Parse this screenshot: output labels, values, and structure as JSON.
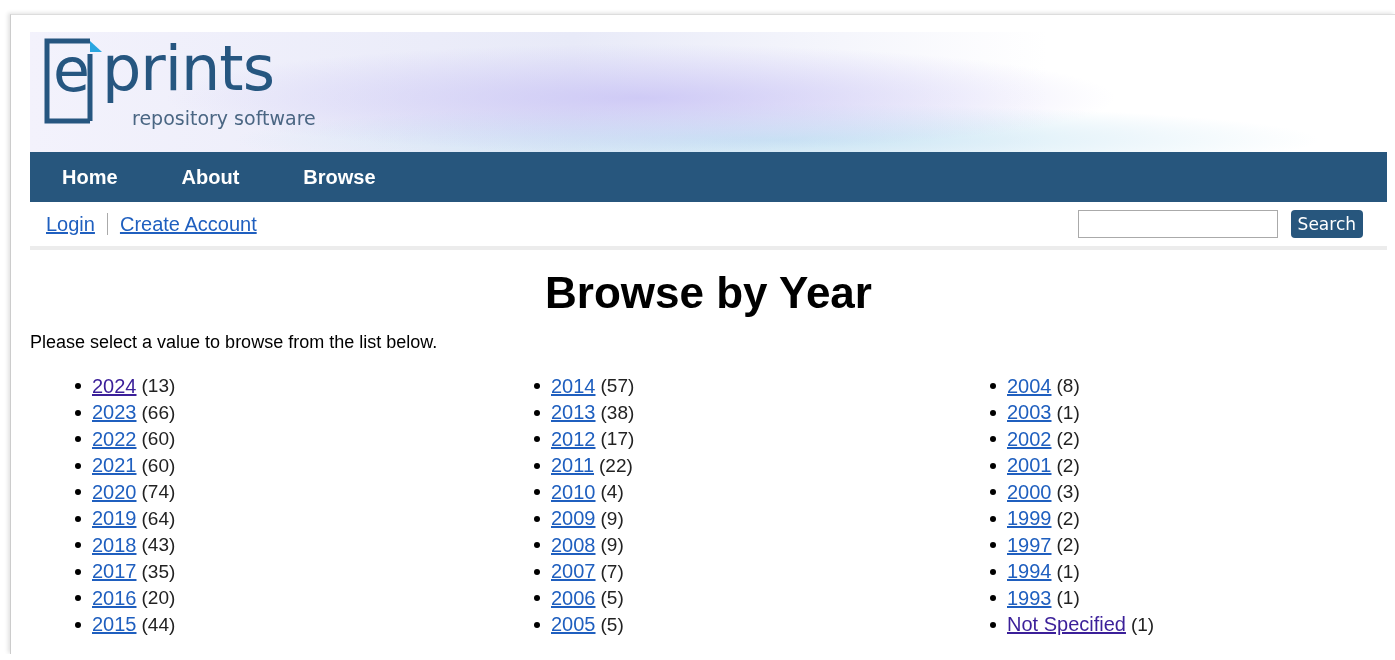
{
  "logo": {
    "letter": "e",
    "name": "prints",
    "tagline": "repository software"
  },
  "nav": [
    {
      "label": "Home"
    },
    {
      "label": "About"
    },
    {
      "label": "Browse"
    }
  ],
  "account_links": [
    {
      "label": "Login"
    },
    {
      "label": "Create Account"
    }
  ],
  "search": {
    "button": "Search"
  },
  "heading": "Browse by Year",
  "intro": "Please select a value to browse from the list below.",
  "columns": [
    [
      {
        "label": "2024",
        "count": "(13)",
        "visited": true
      },
      {
        "label": "2023",
        "count": "(66)",
        "visited": false
      },
      {
        "label": "2022",
        "count": "(60)",
        "visited": false
      },
      {
        "label": "2021",
        "count": "(60)",
        "visited": false
      },
      {
        "label": "2020",
        "count": "(74)",
        "visited": false
      },
      {
        "label": "2019",
        "count": "(64)",
        "visited": false
      },
      {
        "label": "2018",
        "count": "(43)",
        "visited": false
      },
      {
        "label": "2017",
        "count": "(35)",
        "visited": false
      },
      {
        "label": "2016",
        "count": "(20)",
        "visited": false
      },
      {
        "label": "2015",
        "count": "(44)",
        "visited": false
      }
    ],
    [
      {
        "label": "2014",
        "count": "(57)",
        "visited": false
      },
      {
        "label": "2013",
        "count": "(38)",
        "visited": false
      },
      {
        "label": "2012",
        "count": "(17)",
        "visited": false
      },
      {
        "label": "2011",
        "count": "(22)",
        "visited": false
      },
      {
        "label": "2010",
        "count": "(4)",
        "visited": false
      },
      {
        "label": "2009",
        "count": "(9)",
        "visited": false
      },
      {
        "label": "2008",
        "count": "(9)",
        "visited": false
      },
      {
        "label": "2007",
        "count": "(7)",
        "visited": false
      },
      {
        "label": "2006",
        "count": "(5)",
        "visited": false
      },
      {
        "label": "2005",
        "count": "(5)",
        "visited": false
      }
    ],
    [
      {
        "label": "2004",
        "count": "(8)",
        "visited": false
      },
      {
        "label": "2003",
        "count": "(1)",
        "visited": false
      },
      {
        "label": "2002",
        "count": "(2)",
        "visited": false
      },
      {
        "label": "2001",
        "count": "(2)",
        "visited": false
      },
      {
        "label": "2000",
        "count": "(3)",
        "visited": false
      },
      {
        "label": "1999",
        "count": "(2)",
        "visited": false
      },
      {
        "label": "1997",
        "count": "(2)",
        "visited": false
      },
      {
        "label": "1994",
        "count": "(1)",
        "visited": false
      },
      {
        "label": "1993",
        "count": "(1)",
        "visited": false
      },
      {
        "label": "Not Specified",
        "count": "(1)",
        "visited": true
      }
    ]
  ]
}
